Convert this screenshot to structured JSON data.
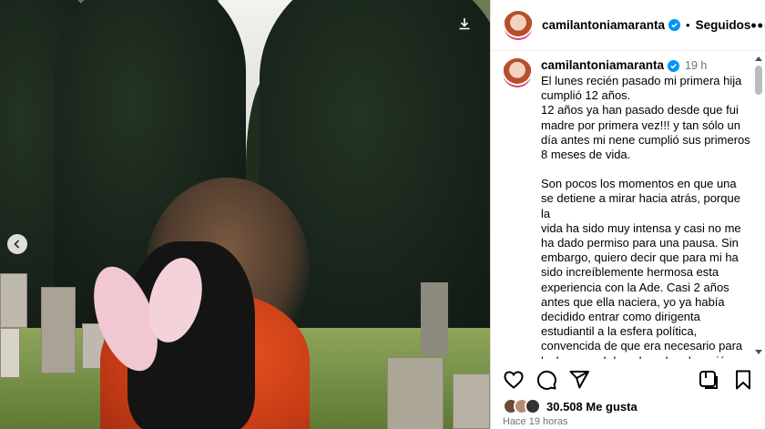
{
  "post": {
    "username": "camilantoniamaranta",
    "follow_label": "Seguidos",
    "separator": "•",
    "more_label": "•••"
  },
  "caption": {
    "username": "camilantoniamaranta",
    "time": "19 h",
    "lines": [
      "El lunes recién pasado mi primera hija",
      "cumplió 12 años.",
      "12 años ya han pasado desde que fui",
      "madre por primera vez!!! y tan sólo un",
      "día antes mi nene cumplió sus primeros",
      "8 meses de vida.",
      "",
      "Son pocos los momentos en que una",
      "se detiene a mirar hacia atrás, porque la",
      "vida ha sido muy intensa y casi no me",
      "ha dado permiso para una pausa. Sin",
      "embargo, quiero decir que para mi ha",
      "sido increíblemente hermosa esta",
      "experiencia con la Ade. Casi 2 años",
      "antes que ella naciera, yo ya había",
      "decidido entrar como dirigenta",
      "estudiantil a la esfera política,",
      "convencida de que era necesario para",
      "luchar por el derecho a la educación,"
    ]
  },
  "stats": {
    "likes": "30.508 Me gusta",
    "time_ago": "Hace 19 horas"
  },
  "icons": {
    "like": "heart-icon",
    "comment": "comment-icon",
    "share": "send-icon",
    "save": "bookmark-icon",
    "verified": "verified-badge-icon",
    "download": "download-icon",
    "prev": "chevron-left-icon",
    "repost": "repost-icon"
  },
  "colors": {
    "verified": "#0095f6",
    "muted": "#737373"
  }
}
